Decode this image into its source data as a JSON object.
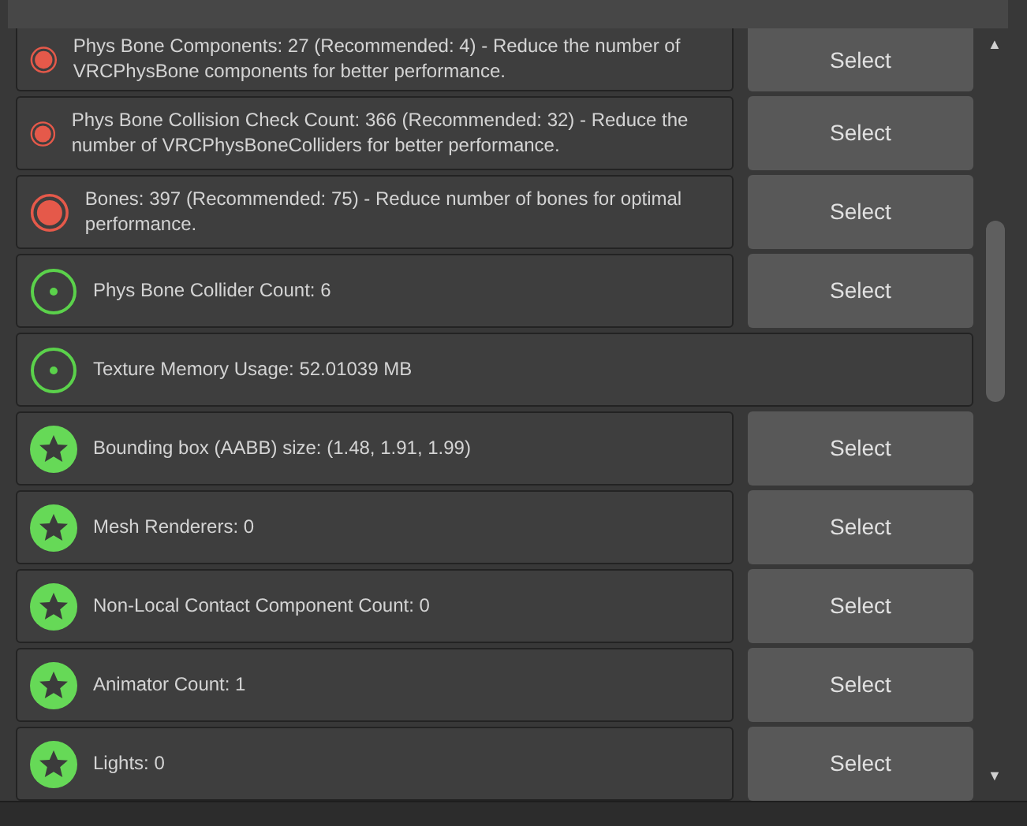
{
  "rows": [
    {
      "kind": "poor",
      "message": "Phys Bone Components: 27 (Recommended: 4) - Reduce the number of VRCPhysBone components for better performance.",
      "button": "Select"
    },
    {
      "kind": "poor",
      "message": "Phys Bone Collision Check Count: 366 (Recommended: 32) - Reduce the number of VRCPhysBoneColliders for better performance.",
      "button": "Select"
    },
    {
      "kind": "poor",
      "message": "Bones: 397 (Recommended: 75) - Reduce number of bones for optimal performance.",
      "button": "Select"
    },
    {
      "kind": "good",
      "message": "Phys Bone Collider Count: 6",
      "button": "Select"
    },
    {
      "kind": "good",
      "message": "Texture Memory Usage: 52.01039 MB"
    },
    {
      "kind": "excellent",
      "message": "Bounding box (AABB) size: (1.48, 1.91, 1.99)",
      "button": "Select"
    },
    {
      "kind": "excellent",
      "message": "Mesh Renderers: 0",
      "button": "Select"
    },
    {
      "kind": "excellent",
      "message": "Non-Local Contact Component Count: 0",
      "button": "Select"
    },
    {
      "kind": "excellent",
      "message": "Animator Count: 1",
      "button": "Select"
    },
    {
      "kind": "excellent",
      "message": "Lights: 0",
      "button": "Select"
    }
  ],
  "scrollbar": {
    "up": "▲",
    "down": "▼"
  }
}
